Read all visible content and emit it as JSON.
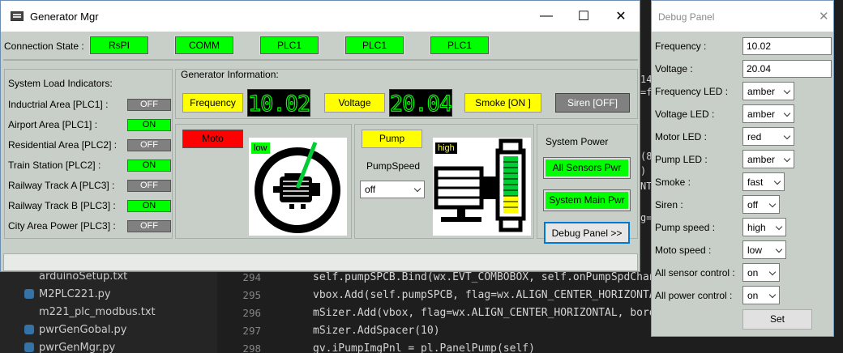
{
  "editor": {
    "files": [
      {
        "name": "arduinoSetup.txt",
        "type": "txt"
      },
      {
        "name": "M2PLC221.py",
        "type": "py"
      },
      {
        "name": "m221_plc_modbus.txt",
        "type": "txt"
      },
      {
        "name": "pwrGenGobal.py",
        "type": "py"
      },
      {
        "name": "pwrGenMgr.py",
        "type": "py"
      }
    ],
    "line_numbers": [
      "294",
      "295",
      "296",
      "297",
      "298"
    ],
    "code_lines": [
      "self.pumpSPCB.Bind(wx.EVT_COMBOBOX, self.onPumpSpdChang",
      "vbox.Add(self.pumpSPCB, flag=wx.ALIGN_CENTER_HORIZONTAL",
      "mSizer.Add(vbox, flag=wx.ALIGN_CENTER_HORIZONTAL, borde",
      "mSizer.AddSpacer(10)",
      "gv.iPumpImgPnl = pl.PanelPump(self)"
    ],
    "fragments": [
      "14",
      "=f",
      "(8",
      ")",
      "NTA",
      "g=w"
    ]
  },
  "main_window": {
    "title": "Generator Mgr",
    "controls": {
      "minimize": "—",
      "maximize": "☐",
      "close": "✕"
    },
    "connection": {
      "label": "Connection State :",
      "items": [
        "RsPI",
        "COMM",
        "PLC1",
        "PLC1",
        "PLC1"
      ]
    },
    "load_indicators": {
      "title": "System Load Indicators:",
      "rows": [
        {
          "label": "Inductrial Area [PLC1] :",
          "state": "OFF"
        },
        {
          "label": "Airport Area [PLC1] :",
          "state": "ON"
        },
        {
          "label": "Residential Area [PLC2] :",
          "state": "OFF"
        },
        {
          "label": "Train Station [PLC2] :",
          "state": "ON"
        },
        {
          "label": "Railway Track A [PLC3] :",
          "state": "OFF"
        },
        {
          "label": "Railway Track B [PLC3] :",
          "state": "ON"
        },
        {
          "label": "City Area Power [PLC3] :",
          "state": "OFF"
        }
      ]
    },
    "generator": {
      "title": "Generator Information:",
      "frequency_label": "Frequency",
      "frequency_value": "10.02",
      "voltage_label": "Voltage",
      "voltage_value": "20.04",
      "smoke_label": "Smoke [ON ]",
      "siren_label": "Siren [OFF]",
      "moto_label": "Moto",
      "moto_speed_tag": "low",
      "pump_label": "Pump",
      "pump_speed_label": "PumpSpeed",
      "pump_speed_value": "off",
      "pump_tag": "high",
      "pump_level_fraction": 0.3
    },
    "system_power": {
      "title": "System Power",
      "all_sensors": "All Sensors Pwr",
      "system_main": "System Main Pwr",
      "debug_button": "Debug Panel >>"
    },
    "colors": {
      "green": "#00ff00",
      "yellow": "#ffff00",
      "red": "#ff0000",
      "grey": "#808080"
    }
  },
  "debug_panel": {
    "title": "Debug Panel",
    "fields": [
      {
        "label": "Frequency :",
        "value": "10.02",
        "kind": "text"
      },
      {
        "label": "Voltage :",
        "value": "20.04",
        "kind": "text"
      },
      {
        "label": "Frequency LED :",
        "value": "amber",
        "kind": "select"
      },
      {
        "label": "Voltage LED :",
        "value": "amber",
        "kind": "select"
      },
      {
        "label": "Motor LED :",
        "value": "red",
        "kind": "select"
      },
      {
        "label": "Pump LED :",
        "value": "amber",
        "kind": "select"
      },
      {
        "label": "Smoke :",
        "value": "fast",
        "kind": "select"
      },
      {
        "label": "Siren :",
        "value": "off",
        "kind": "select"
      },
      {
        "label": "Pump speed :",
        "value": "high",
        "kind": "select"
      },
      {
        "label": "Moto speed :",
        "value": "low",
        "kind": "select"
      },
      {
        "label": "All sensor control :",
        "value": "on",
        "kind": "select"
      },
      {
        "label": "All power control :",
        "value": "on",
        "kind": "select"
      }
    ],
    "set_label": "Set"
  }
}
